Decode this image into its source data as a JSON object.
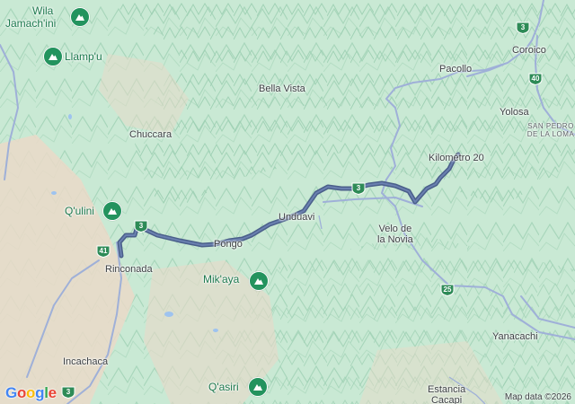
{
  "map": {
    "places": {
      "wila_jamachini": [
        "Wila",
        "Jamach'ini"
      ],
      "llampu": "Llamp'u",
      "chuccara": "Chuccara",
      "bella_vista": "Bella Vista",
      "pacollo": "Pacollo",
      "coroico": "Coroico",
      "yolosa": "Yolosa",
      "san_pedro": [
        "SAN PEDRO",
        "DE LA LOMA"
      ],
      "kilometro_20": "Kilométro 20",
      "qulini": "Q'ulini",
      "unduavi": "Unduavi",
      "pongo": "Pongo",
      "velo_de_la_novia": [
        "Velo de",
        "la Novia"
      ],
      "rinconada": "Rinconada",
      "mikaya": "Mik'aya",
      "incachaca": "Incachaca",
      "qasiri": "Q'asiri",
      "estancia_cacapi": [
        "Estancia",
        "Cacapi"
      ],
      "yanacachi": "Yanacachi"
    },
    "route_shields": {
      "r3_north": "3",
      "r40": "40",
      "r3_middle": "3",
      "r3_west": "3",
      "r41": "41",
      "r25": "25",
      "r3_south": "3"
    },
    "icons": {
      "peak": "mountain-icon",
      "route_shield": "shield-icon"
    },
    "colors": {
      "terrain_light": "#c9e9d4",
      "terrain_dark": "#9fd1b4",
      "urban": "#ead9c8",
      "route_highlight": "#4a5f8a",
      "road": "#9fb0d8",
      "peak_pin": "#23935e",
      "shield_green": "#2e8b57"
    },
    "google_logo": [
      "G",
      "o",
      "o",
      "g",
      "l",
      "e"
    ],
    "attribution": "Map data ©2026"
  }
}
